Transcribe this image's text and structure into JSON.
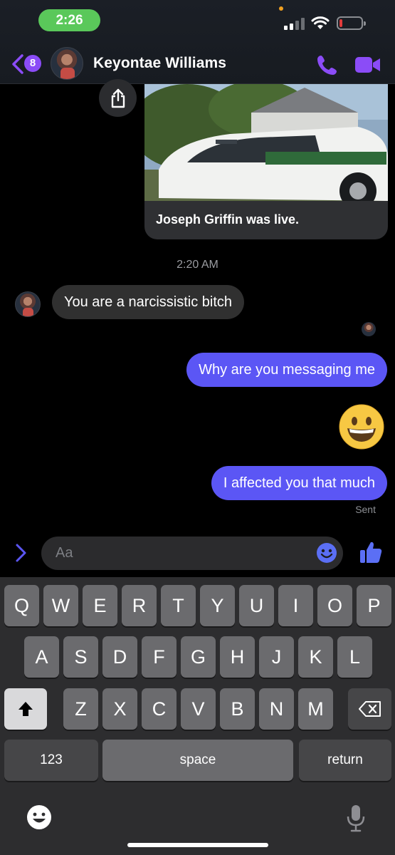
{
  "status_bar": {
    "time": "2:26"
  },
  "header": {
    "back_badge_count": "8",
    "contact_name": "Keyontae Williams",
    "accent_color": "#8b4cf7"
  },
  "shared_post": {
    "caption": "Joseph Griffin was live."
  },
  "conversation": {
    "timestamp": "2:20 AM",
    "incoming": [
      {
        "text": "You are a narcissistic bitch"
      }
    ],
    "outgoing": [
      {
        "text": "Why are you messaging me"
      },
      {
        "text": "😀"
      },
      {
        "text": "I affected you that much"
      }
    ],
    "sent_status": "Sent",
    "outgoing_color": "#5b56f5",
    "incoming_color": "#303030"
  },
  "composer": {
    "placeholder": "Aa"
  },
  "keyboard": {
    "row1": [
      "Q",
      "W",
      "E",
      "R",
      "T",
      "Y",
      "U",
      "I",
      "O",
      "P"
    ],
    "row2": [
      "A",
      "S",
      "D",
      "F",
      "G",
      "H",
      "J",
      "K",
      "L"
    ],
    "row3": [
      "Z",
      "X",
      "C",
      "V",
      "B",
      "N",
      "M"
    ],
    "numbers_label": "123",
    "space_label": "space",
    "return_label": "return"
  }
}
